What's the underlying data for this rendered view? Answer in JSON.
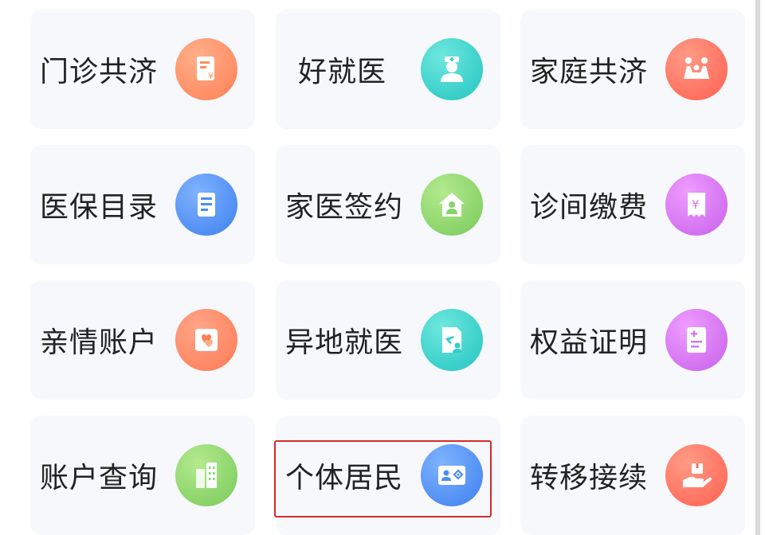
{
  "tiles": [
    {
      "label": "门诊共济",
      "icon": "bill-icon"
    },
    {
      "label": "好就医",
      "icon": "doctor-icon"
    },
    {
      "label": "家庭共济",
      "icon": "family-icon"
    },
    {
      "label": "医保目录",
      "icon": "document-list-icon"
    },
    {
      "label": "家医签约",
      "icon": "house-icon"
    },
    {
      "label": "诊间缴费",
      "icon": "yuan-receipt-icon"
    },
    {
      "label": "亲情账户",
      "icon": "hearts-icon"
    },
    {
      "label": "异地就医",
      "icon": "airplane-person-icon"
    },
    {
      "label": "权益证明",
      "icon": "certificate-icon"
    },
    {
      "label": "账户查询",
      "icon": "buildings-icon"
    },
    {
      "label": "个体居民",
      "icon": "id-card-icon"
    },
    {
      "label": "转移接续",
      "icon": "hand-box-icon"
    }
  ],
  "highlighted_tile": "个体居民",
  "colors": {
    "orange": "#ff8d5c",
    "teal": "#2fd1c7",
    "red": "#ff6a5a",
    "blue": "#4a8df6",
    "green": "#86d46a",
    "purple": "#d07af0",
    "highlight": "#d52b2b"
  }
}
